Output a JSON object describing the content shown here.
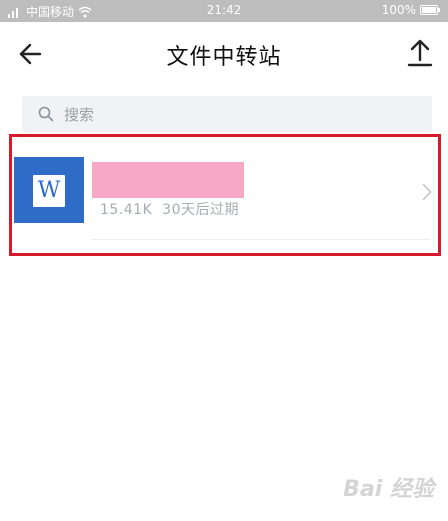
{
  "status_bar": {
    "carrier": "中国移动",
    "time": "21:42",
    "battery": "100%"
  },
  "nav": {
    "title": "文件中转站",
    "back_icon": "arrow-left-icon",
    "upload_icon": "upload-icon"
  },
  "search": {
    "placeholder": "搜索"
  },
  "files": [
    {
      "type_badge": "W",
      "size": "15.41K",
      "expiry": "30天后过期",
      "icon": "word-doc-icon"
    }
  ],
  "watermark": "Bai 经验",
  "colors": {
    "accent": "#2e6cc8",
    "highlight": "#d7192b",
    "redaction": "#f7a8c4"
  }
}
